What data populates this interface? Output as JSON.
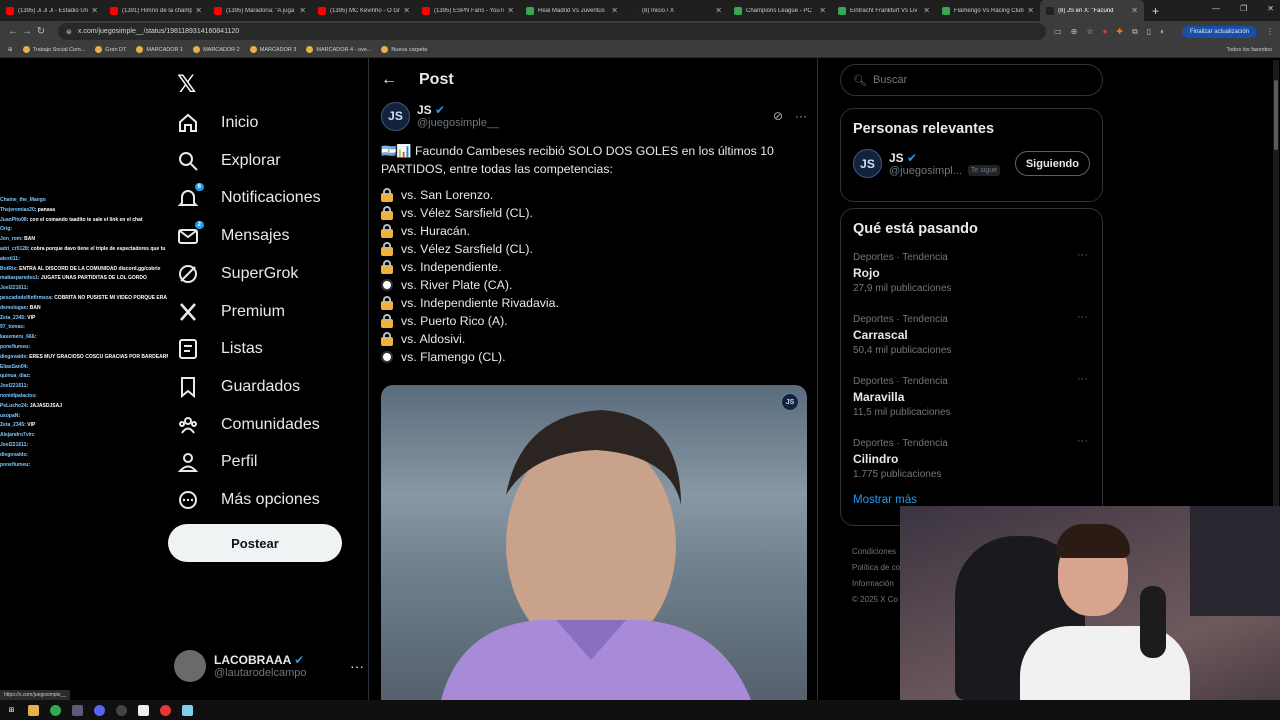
{
  "browser": {
    "tabs": [
      {
        "title": "(1395) Ji Ji Ji - Estadio Úni",
        "color": "#ff0000"
      },
      {
        "title": "(1391) Himno de la champ",
        "color": "#ff0000"
      },
      {
        "title": "(1395) Maradona: \"A juga",
        "color": "#ff0000"
      },
      {
        "title": "(1395) MC Kevinho - O Gr",
        "color": "#ff0000"
      },
      {
        "title": "(1395) ESPN Fans - YouTub",
        "color": "#ff0000"
      },
      {
        "title": "Real Madrid Vs Juventus",
        "color": "#34a853"
      },
      {
        "title": "(8) Inicio / X",
        "color": "#202020"
      },
      {
        "title": "Champions League - PC",
        "color": "#34a853"
      },
      {
        "title": "Eintracht Frankfurt Vs Liv",
        "color": "#34a853"
      },
      {
        "title": "Flamengo Vs Racing Club",
        "color": "#34a853"
      },
      {
        "title": "(8) JS en X: \"Facund",
        "color": "#202020"
      }
    ],
    "url": "x.com/juegosimple__/status/1981189314160841120",
    "update_label": "Finalizar actualización",
    "bookmarks": [
      "Trabajo Social Com...",
      "Gran DT",
      "MARCADOR 1",
      "MARCADOR 2",
      "MARCADOR 3",
      "MARCADOR 4 - ove...",
      "Nueva carpeta"
    ],
    "bookmarks_right": "Todos los favoritos",
    "status_url": "https://x.com/juegosimple__"
  },
  "chat": [
    {
      "user": "Chaine_the_Mango",
      "msg": ""
    },
    {
      "user": "Thejeremias20",
      "msg": ": panasa"
    },
    {
      "user": "JuanPito08",
      "msg": ": con el comando taadito te sale el link en el chat"
    },
    {
      "user": "Orig",
      "msg": ":"
    },
    {
      "user": "Jon_rom",
      "msg": ": BAN"
    },
    {
      "user": "adri_cr0128",
      "msg": ": cobra porque davo tiene el triple de espectadores que tu"
    },
    {
      "user": "alexti11",
      "msg": ":"
    },
    {
      "user": "BotRix",
      "msg": ": ENTRA AL DISCORD DE LA COMUNIDAD discord.gg/cobrix"
    },
    {
      "user": "matiasparedes1",
      "msg": ": JUGATE UNAS PARTIDITAS DE LOL GORDO"
    },
    {
      "user": "Joel221611",
      "msg": ":"
    },
    {
      "user": "pescadodelfinfirmeza",
      "msg": ": COBRITA NO PUSISTE MI VIDEO PORQUE ERA JENE"
    },
    {
      "user": "demologan",
      "msg": ": BAN"
    },
    {
      "user": "Zeta_2345",
      "msg": ": VIP"
    },
    {
      "user": "97_tomas",
      "msg": ":"
    },
    {
      "user": "kasemeru_666",
      "msg": ":"
    },
    {
      "user": "ponefiumeu",
      "msg": ":"
    },
    {
      "user": "diegovalde",
      "msg": ": ERES MUY GRACIOSO COSCU GRACIAS POR BARDEARME"
    },
    {
      "user": "EliasSan04",
      "msg": ":"
    },
    {
      "user": "quinua_diaz",
      "msg": ":"
    },
    {
      "user": "Joel221611",
      "msg": ":"
    },
    {
      "user": "nonidipalacios",
      "msg": ":"
    },
    {
      "user": "PeLucho24",
      "msg": ": JAJASDJSAJ"
    },
    {
      "user": "usopaN",
      "msg": ":"
    },
    {
      "user": "Zeta_2345",
      "msg": ": VIP"
    },
    {
      "user": "Alejandro7vin",
      "msg": ":"
    },
    {
      "user": "Joel221611",
      "msg": ":"
    },
    {
      "user": "diegovalde",
      "msg": ":"
    },
    {
      "user": "ponefiumeu",
      "msg": ":"
    }
  ],
  "nav": {
    "items": [
      {
        "label": "Inicio",
        "icon": "home-icon"
      },
      {
        "label": "Explorar",
        "icon": "search-icon"
      },
      {
        "label": "Notificaciones",
        "icon": "bell-icon",
        "badge": "6"
      },
      {
        "label": "Mensajes",
        "icon": "mail-icon",
        "badge": "2"
      },
      {
        "label": "SuperGrok",
        "icon": "grok-icon"
      },
      {
        "label": "Premium",
        "icon": "x-premium-icon"
      },
      {
        "label": "Listas",
        "icon": "list-icon"
      },
      {
        "label": "Guardados",
        "icon": "bookmark-icon"
      },
      {
        "label": "Comunidades",
        "icon": "communities-icon"
      },
      {
        "label": "Perfil",
        "icon": "profile-icon"
      },
      {
        "label": "Más opciones",
        "icon": "more-icon"
      }
    ],
    "post_button": "Postear"
  },
  "account": {
    "name": "LACOBRAAA",
    "handle": "@lautarodelcampo"
  },
  "post": {
    "header": "Post",
    "author": {
      "name": "JS",
      "handle": "@juegosimple__",
      "avatar_text": "JS"
    },
    "text": "Facundo Cambeses recibió SOLO DOS GOLES en los últimos 10 PARTIDOS, entre todas las competencias:",
    "flags": "🇦🇷📊",
    "matches": [
      {
        "icon": "lock",
        "text": "vs. San Lorenzo."
      },
      {
        "icon": "lock",
        "text": "vs. Vélez Sarsfield (CL)."
      },
      {
        "icon": "lock",
        "text": "vs. Huracán."
      },
      {
        "icon": "lock",
        "text": "vs. Vélez Sarsfield (CL)."
      },
      {
        "icon": "lock",
        "text": "vs. Independiente."
      },
      {
        "icon": "ball",
        "text": "vs. River Plate (CA)."
      },
      {
        "icon": "lock",
        "text": "vs. Independiente Rivadavia."
      },
      {
        "icon": "lock",
        "text": "vs. Puerto Rico (A)."
      },
      {
        "icon": "lock",
        "text": "vs. Aldosivi."
      },
      {
        "icon": "ball",
        "text": "vs. Flamengo (CL)."
      }
    ],
    "media_badge": "JS"
  },
  "right": {
    "search_placeholder": "Buscar",
    "relevant_title": "Personas relevantes",
    "relevant": {
      "name": "JS",
      "handle": "@juegosimpl...",
      "follows_you": "Te sigue",
      "button": "Siguiendo"
    },
    "trending_title": "Qué está pasando",
    "trends": [
      {
        "context": "Deportes · Tendencia",
        "name": "Rojo",
        "count": "27,9 mil publicaciones"
      },
      {
        "context": "Deportes · Tendencia",
        "name": "Carrascal",
        "count": "50,4 mil publicaciones"
      },
      {
        "context": "Deportes · Tendencia",
        "name": "Maravilla",
        "count": "11,5 mil publicaciones"
      },
      {
        "context": "Deportes · Tendencia",
        "name": "Cilindro",
        "count": "1.775 publicaciones"
      }
    ],
    "show_more": "Mostrar más",
    "footer": [
      "Condiciones",
      "Política de co",
      "Información",
      "© 2025 X Co"
    ]
  },
  "colors": {
    "accent": "#1d9bf0",
    "background": "#000000",
    "border": "#2f3336"
  }
}
